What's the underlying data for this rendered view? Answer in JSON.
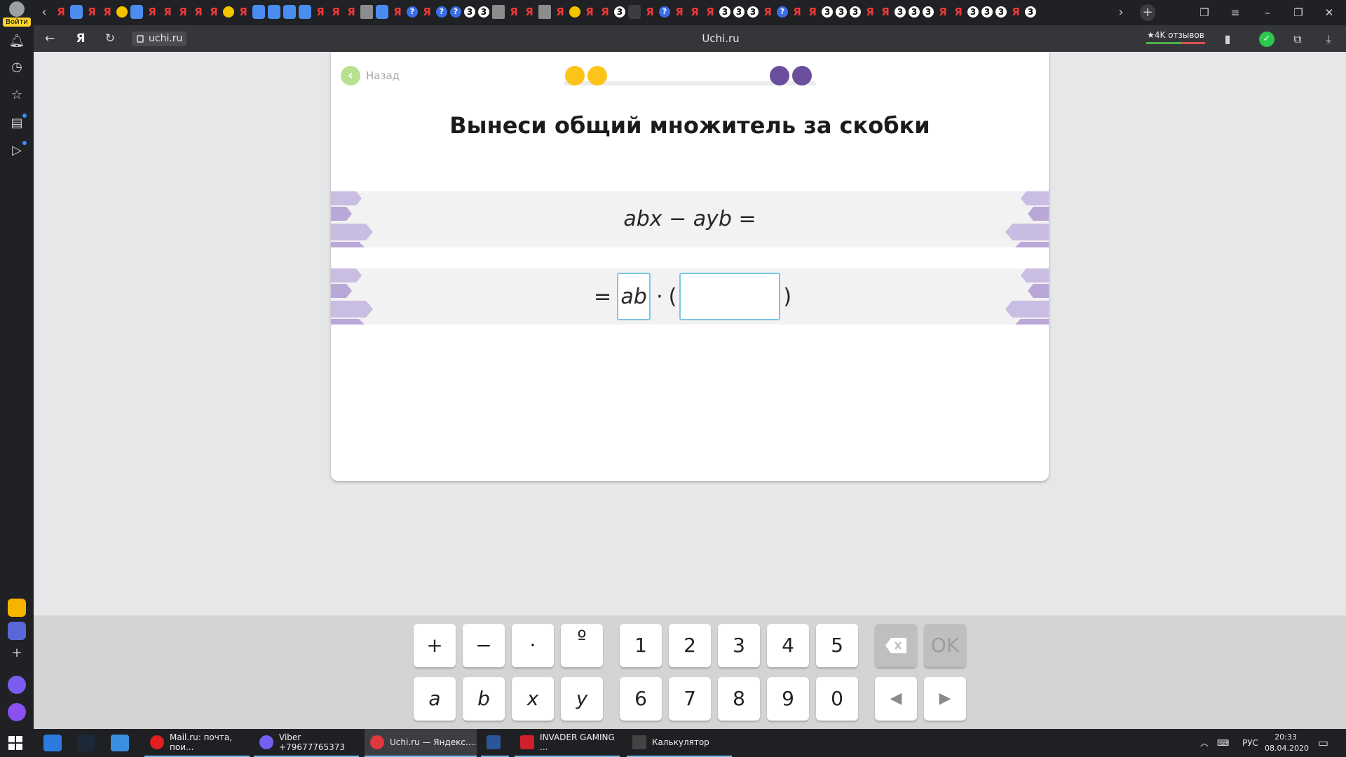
{
  "browser": {
    "login_label": "Войти",
    "address": "uchi.ru",
    "page_title": "Uchi.ru",
    "reviews_label": "★4K отзывов"
  },
  "back_label": "Назад",
  "progress": {
    "completed": 2,
    "total": 4,
    "done_color": "#fcc419",
    "pending_color": "#6a4f9c"
  },
  "task": {
    "title": "Вынеси общий множитель за скобки",
    "expression": "abx − ayb =",
    "answer_prefix": "=",
    "answer_filled": "ab",
    "answer_dot": "·",
    "open_paren": "(",
    "close_paren": ")",
    "answer_empty": ""
  },
  "keyboard": {
    "row1": [
      "+",
      "−",
      "·",
      "º",
      "1",
      "2",
      "3",
      "4",
      "5"
    ],
    "row2": [
      "a",
      "b",
      "x",
      "y",
      "6",
      "7",
      "8",
      "9",
      "0"
    ],
    "ok_label": "OK",
    "backspace_icon": "backspace-icon",
    "left_arrow": "◀",
    "right_arrow": "▶"
  },
  "taskbar": {
    "apps": [
      {
        "label": "Mail.ru: почта, пои...",
        "color": "#e02020"
      },
      {
        "label": "Viber +79677765373",
        "color": "#7360f2"
      },
      {
        "label": "Uchi.ru — Яндекс....",
        "color": "#e0383c"
      },
      {
        "label": "",
        "color": "#2b579a"
      },
      {
        "label": "INVADER GAMING ...",
        "color": "#d0202a"
      },
      {
        "label": "Калькулятор",
        "color": "#444"
      }
    ],
    "lang": "РУС",
    "time": "20:33",
    "date": "08.04.2020"
  },
  "colors": {
    "accent_blue": "#7cc7e6",
    "band_bg": "#f2f2f2",
    "deco_purple": "#b9a7d8"
  }
}
